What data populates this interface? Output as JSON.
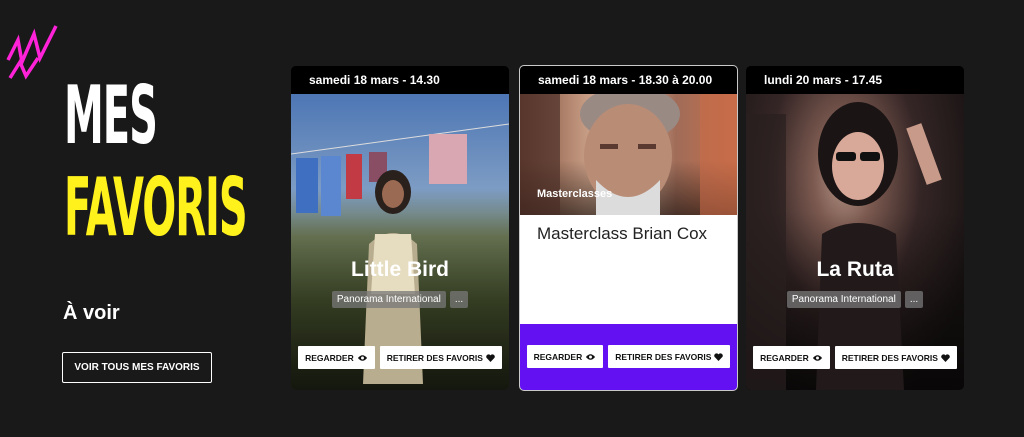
{
  "heading": {
    "line1": "MES",
    "line2": "FAVORIS",
    "subtitle": "À voir",
    "see_all": "VOIR TOUS MES FAVORIS"
  },
  "colors": {
    "background": "#1a1919",
    "accent_yellow": "#fff21c",
    "accent_purple": "#6310f2",
    "deco_pink": "#ff22d8"
  },
  "cards": [
    {
      "date": "samedi 18 mars - 14.30",
      "title": "Little Bird",
      "tag": "Panorama International",
      "more": "...",
      "watch": "REGARDER",
      "remove": "RETIRER DES FAVORIS"
    },
    {
      "date": "samedi 18 mars - 18.30 à 20.00",
      "category": "Masterclasses",
      "title": "Masterclass Brian Cox",
      "watch": "REGARDER",
      "remove": "RETIRER DES FAVORIS"
    },
    {
      "date": "lundi 20 mars - 17.45",
      "title": "La Ruta",
      "tag": "Panorama International",
      "more": "...",
      "watch": "REGARDER",
      "remove": "RETIRER DES FAVORIS"
    }
  ],
  "icons": {
    "watch": "eye-icon",
    "remove": "heart-icon",
    "deco": "zigzag-icon"
  }
}
